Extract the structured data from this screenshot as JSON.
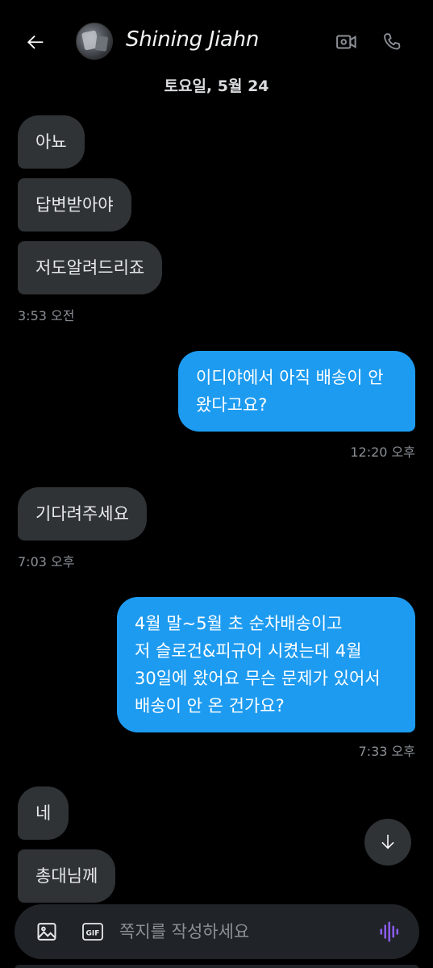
{
  "header": {
    "contact_name": "Shining Jiahn",
    "icons": {
      "back": "arrow-left-icon",
      "video": "video-camera-icon",
      "call": "phone-icon"
    }
  },
  "date_separator": "토요일, 5월 24",
  "messages": [
    {
      "direction": "incoming",
      "text": "아뇨"
    },
    {
      "direction": "incoming",
      "text": "답변받아야"
    },
    {
      "direction": "incoming",
      "text": "저도알려드리죠",
      "time": "3:53 오전"
    },
    {
      "direction": "outgoing",
      "lines": [
        "이디야에서 아직 배송이 안",
        "왔다고요?"
      ],
      "time": "12:20 오후"
    },
    {
      "direction": "incoming",
      "text": "기다려주세요",
      "time": "7:03 오후"
    },
    {
      "direction": "outgoing",
      "lines": [
        "4월 말~5월 초 순차배송이고",
        "저 슬로건&피규어 시켰는데 4월",
        "30일에 왔어요 무슨 문제가 있어서",
        "배송이 안 온 건가요?"
      ],
      "time": "7:33 오후"
    },
    {
      "direction": "incoming",
      "text": "네"
    },
    {
      "direction": "incoming",
      "text": "총대님께"
    }
  ],
  "composer": {
    "placeholder": "쪽지를 작성하세요",
    "gif_label": "GIF"
  },
  "colors": {
    "background": "#000000",
    "incoming_bubble": "#2f3336",
    "outgoing_bubble": "#1d9bf0",
    "voice_accent": "#8b5cf6"
  }
}
